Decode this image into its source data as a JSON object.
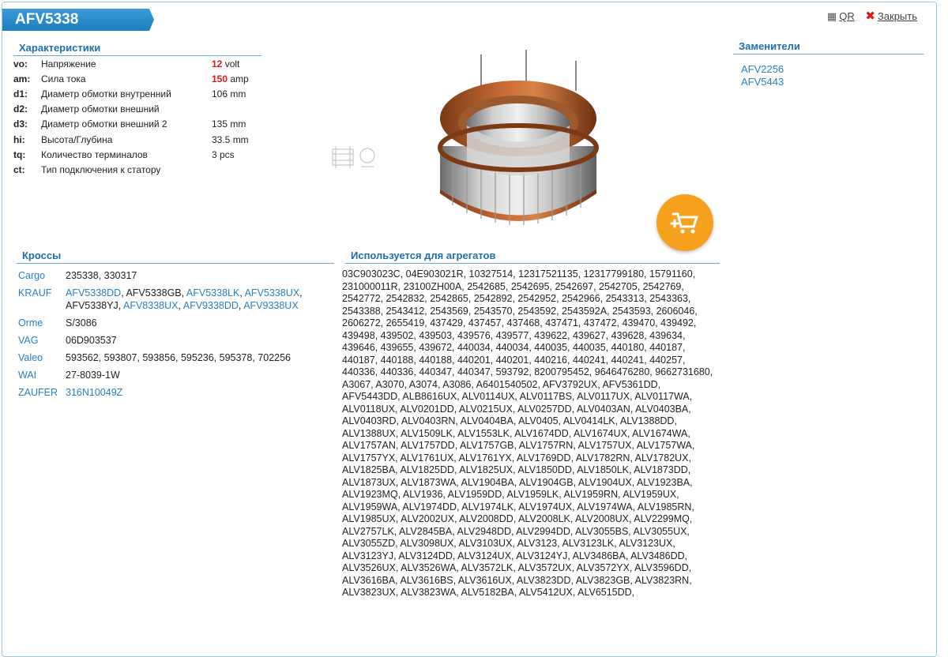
{
  "part_number": "AFV5338",
  "top_links": {
    "qr": "QR",
    "close": "Закрыть"
  },
  "characteristics": {
    "title": "Характеристики",
    "rows": [
      {
        "code": "vo:",
        "label": "Напряжение",
        "value": "12",
        "unit": " volt"
      },
      {
        "code": "am:",
        "label": "Сила тока",
        "value": "150",
        "unit": " amp"
      },
      {
        "code": "d1:",
        "label": "Диаметр обмотки внутренний",
        "value": "",
        "unit": "106 mm"
      },
      {
        "code": "d2:",
        "label": "Диаметр обмотки внешний",
        "value": "",
        "unit": ""
      },
      {
        "code": "d3:",
        "label": "Диаметр обмотки внешний 2",
        "value": "",
        "unit": "135 mm"
      },
      {
        "code": "hi:",
        "label": "Высота/Глубина",
        "value": "",
        "unit": "33.5 mm"
      },
      {
        "code": "tq:",
        "label": "Количество терминалов",
        "value": "",
        "unit": "3 pcs"
      },
      {
        "code": "ct:",
        "label": "Тип подключения к статору",
        "value": "",
        "unit": ""
      }
    ]
  },
  "substitutes": {
    "title": "Заменители",
    "items": [
      "AFV2256",
      "AFV5443"
    ]
  },
  "crosses": {
    "title": "Кроссы",
    "rows": [
      {
        "brand": "Cargo",
        "codes": "235338, 330317"
      },
      {
        "brand": "KRAUF",
        "codes_rich": [
          {
            "t": "AFV5338DD",
            "link": true
          },
          {
            "t": ", ",
            "link": false
          },
          {
            "t": "AFV5338GB",
            "link": false
          },
          {
            "t": ", ",
            "link": false
          },
          {
            "t": "AFV5338LK",
            "link": true
          },
          {
            "t": ", ",
            "link": false
          },
          {
            "t": "AFV5338UX",
            "link": true
          },
          {
            "t": ", ",
            "link": false
          },
          {
            "t": "AFV5338YJ",
            "link": false
          },
          {
            "t": ", ",
            "link": false
          },
          {
            "t": "AFV8338UX",
            "link": true
          },
          {
            "t": ", ",
            "link": false
          },
          {
            "t": "AFV9338DD",
            "link": true
          },
          {
            "t": ", ",
            "link": false
          },
          {
            "t": "AFV9338UX",
            "link": true
          }
        ]
      },
      {
        "brand": "Orme",
        "codes": "S/3086"
      },
      {
        "brand": "VAG",
        "codes": "06D903537"
      },
      {
        "brand": "Valeo",
        "codes": "593562, 593807, 593856, 595236, 595378, 702256"
      },
      {
        "brand": "WAI",
        "codes": "27-8039-1W"
      },
      {
        "brand": "ZAUFER",
        "codes_rich": [
          {
            "t": "316N10049Z",
            "link": true
          }
        ]
      }
    ]
  },
  "usage": {
    "title": "Используется для агрегатов",
    "text": "03C903023C, 04E903021R, 10327514, 12317521135, 12317799180, 15791160, 231000011R, 23100ZH00A, 2542685, 2542695, 2542697, 2542705, 2542769, 2542772, 2542832, 2542865, 2542892, 2542952, 2542966, 2543313, 2543363, 2543388, 2543412, 2543569, 2543570, 2543592, 2543592A, 2543593, 2606046, 2606272, 2655419, 437429, 437457, 437468, 437471, 437472, 439470, 439492, 439498, 439502, 439503, 439576, 439577, 439622, 439627, 439628, 439634, 439646, 439655, 439672, 440034, 440034, 440035, 440035, 440180, 440187, 440187, 440188, 440188, 440201, 440201, 440216, 440241, 440241, 440257, 440336, 440336, 440347, 440347, 593792, 8200795452, 9646476280, 9662731680, A3067, A3070, A3074, A3086, A6401540502, AFV3792UX, AFV5361DD, AFV5443DD, ALB8616UX, ALV0114UX, ALV0117BS, ALV0117UX, ALV0117WA, ALV0118UX, ALV0201DD, ALV0215UX, ALV0257DD, ALV0403AN, ALV0403BA, ALV0403RD, ALV0403RN, ALV0404BA, ALV0405, ALV0414LK, ALV1388DD, ALV1388UX, ALV1509LK, ALV1553LK, ALV1674DD, ALV1674UX, ALV1674WA, ALV1757AN, ALV1757DD, ALV1757GB, ALV1757RN, ALV1757UX, ALV1757WA, ALV1757YX, ALV1761UX, ALV1761YX, ALV1769DD, ALV1782RN, ALV1782UX, ALV1825BA, ALV1825DD, ALV1825UX, ALV1850DD, ALV1850LK, ALV1873DD, ALV1873UX, ALV1873WA, ALV1904BA, ALV1904GB, ALV1904UX, ALV1923BA, ALV1923MQ, ALV1936, ALV1959DD, ALV1959LK, ALV1959RN, ALV1959UX, ALV1959WA, ALV1974DD, ALV1974LK, ALV1974UX, ALV1974WA, ALV1985RN, ALV1985UX, ALV2002UX, ALV2008DD, ALV2008LK, ALV2008UX, ALV2299MQ, ALV2757LK, ALV2845BA, ALV2948DD, ALV2994DD, ALV3055BS, ALV3055UX, ALV3055ZD, ALV3098UX, ALV3103UX, ALV3123, ALV3123LK, ALV3123UX, ALV3123YJ, ALV3124DD, ALV3124UX, ALV3124YJ, ALV3486BA, ALV3486DD, ALV3526UX, ALV3526WA, ALV3572LK, ALV3572UX, ALV3572YX, ALV3596DD, ALV3616BA, ALV3616BS, ALV3616UX, ALV3823DD, ALV3823GB, ALV3823RN, ALV3823UX, ALV3823WA, ALV5182BA, ALV5412UX, ALV6515DD,"
  },
  "colors": {
    "accent": "#1d7fc0",
    "link": "#2a7ec0",
    "highlight": "#e01818",
    "cart": "#f6a11e"
  }
}
